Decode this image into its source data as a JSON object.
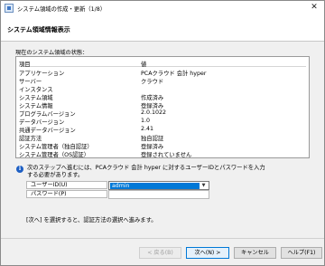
{
  "window": {
    "title": "システム領域の作成・更新（1/8）",
    "close_glyph": "✕"
  },
  "header": {
    "heading": "システム領域情報表示"
  },
  "status": {
    "label": "現在のシステム領域の状態：",
    "columns": [
      "項目",
      "値"
    ],
    "rows": [
      {
        "key": "アプリケーション",
        "value": "PCAクラウド 会計 hyper"
      },
      {
        "key": "サーバー",
        "value": "クラウド"
      },
      {
        "key": "インスタンス",
        "value": ""
      },
      {
        "key": "システム領域",
        "value": "作成済み"
      },
      {
        "key": "システム情報",
        "value": "登録済み"
      },
      {
        "key": "プログラムバージョン",
        "value": "2.0.1022"
      },
      {
        "key": "データバージョン",
        "value": "1.0"
      },
      {
        "key": "共通データバージョン",
        "value": "2.41"
      },
      {
        "key": "認証方法",
        "value": "独自認証"
      },
      {
        "key": "システム管理者（独自認証）",
        "value": "登録済み"
      },
      {
        "key": "システム管理者（OS認証）",
        "value": "登録されていません"
      }
    ]
  },
  "info": {
    "icon": "info-icon",
    "line1": "次のステップへ進むには、PCAクラウド 会計 hyper に対するユーザーIDとパスワードを入力",
    "line2": "する必要があります。"
  },
  "form": {
    "user_label": "ユーザーID(U)",
    "user_value": "admin",
    "password_label": "パスワード(P)",
    "password_value": ""
  },
  "hint": "[次へ] を選択すると、認証方法の選択へ進みます。",
  "buttons": {
    "back": "< 戻る(B)",
    "next": "次へ(N) >",
    "cancel": "キャンセル",
    "help": "ヘルプ(F1)"
  },
  "colors": {
    "selection": "#0078d7",
    "info_icon": "#1d5fc4"
  }
}
